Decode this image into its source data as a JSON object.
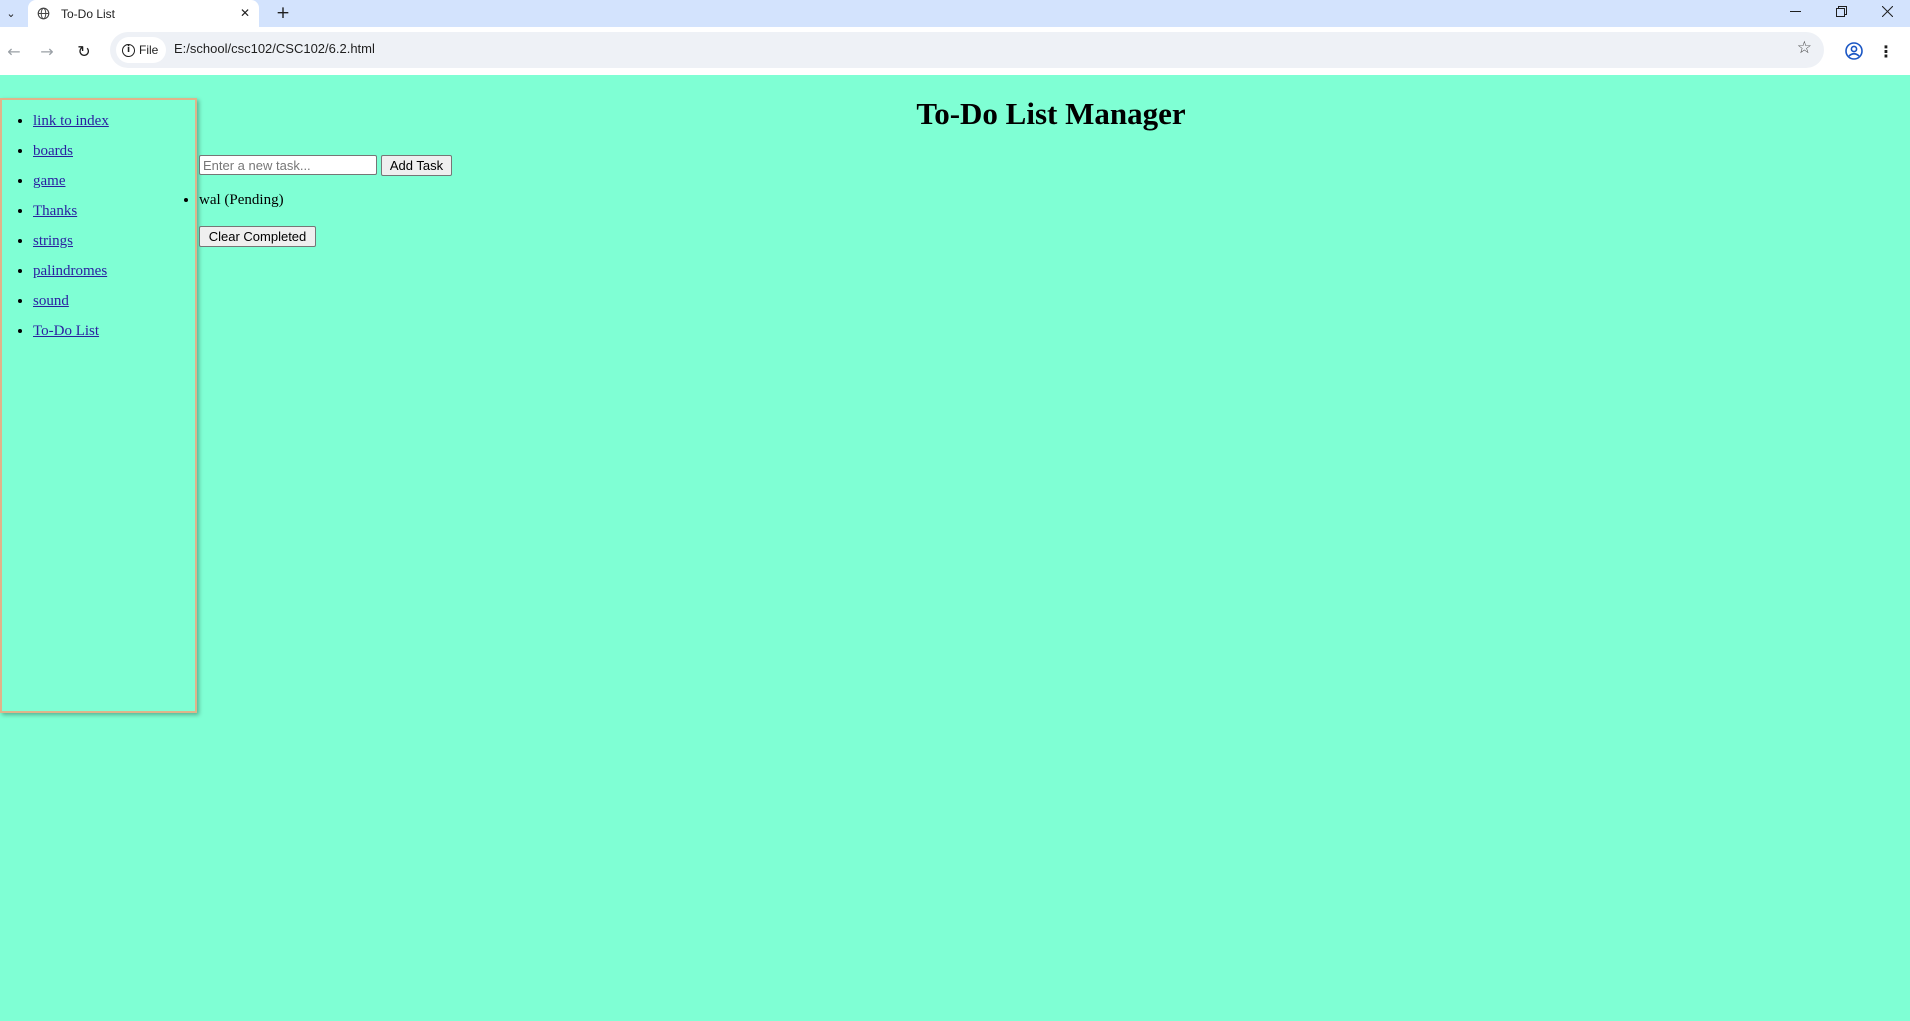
{
  "browser": {
    "tab_title": "To-Do List",
    "site_chip_label": "File",
    "url": "E:/school/csc102/CSC102/6.2.html",
    "new_tab_icon": "plus-icon",
    "tab_close_icon": "close-icon"
  },
  "sidebar": {
    "links": [
      {
        "label": "link to index"
      },
      {
        "label": "boards"
      },
      {
        "label": "game"
      },
      {
        "label": "Thanks"
      },
      {
        "label": "strings"
      },
      {
        "label": "palindromes"
      },
      {
        "label": "sound"
      },
      {
        "label": "To-Do List"
      }
    ]
  },
  "main": {
    "title": "To-Do List Manager",
    "task_input_placeholder": "Enter a new task...",
    "task_input_value": "",
    "add_button_label": "Add Task",
    "tasks": [
      {
        "text": "wal (Pending)"
      }
    ],
    "clear_button_label": "Clear Completed"
  },
  "colors": {
    "page_background": "#7fffd4",
    "sidebar_border": "#e0b48a",
    "tabstrip_background": "#d3e3fd"
  }
}
